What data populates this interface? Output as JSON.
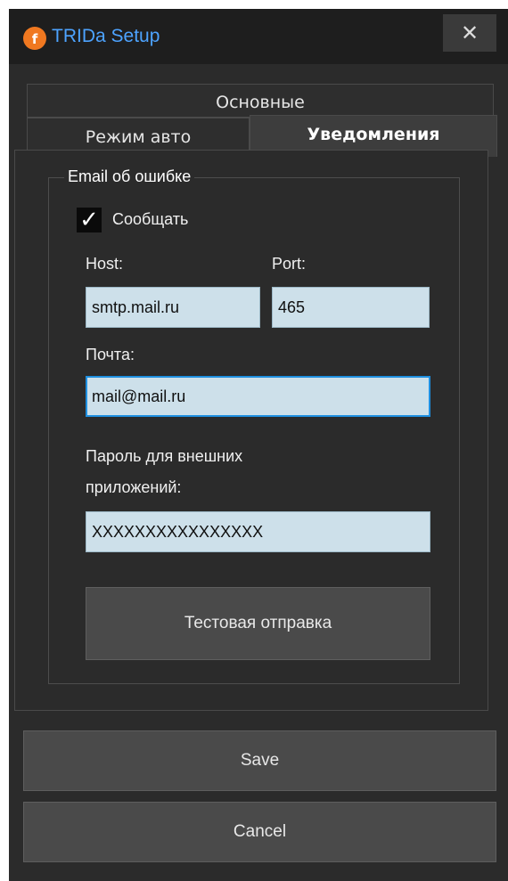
{
  "window": {
    "title": "TRIDa Setup",
    "close_label": "✕"
  },
  "tabs": [
    {
      "label": "Основные"
    },
    {
      "label": "Режим авто"
    },
    {
      "label": "Уведомления"
    }
  ],
  "notifications": {
    "group_title": "Email об ошибке",
    "report_checkbox": {
      "label": "Сообщать",
      "checked": true
    },
    "host": {
      "label": "Host:",
      "value": "smtp.mail.ru"
    },
    "port": {
      "label": "Port:",
      "value": "465"
    },
    "email": {
      "label": "Почта:",
      "value": "mail@mail.ru"
    },
    "password": {
      "label_line1": "Пароль для внешних",
      "label_line2": "приложений:",
      "value": "XXXXXXXXXXXXXXXX"
    },
    "test_button": "Тестовая отправка"
  },
  "footer": {
    "save": "Save",
    "cancel": "Cancel"
  },
  "colors": {
    "accent": "#4da3ff",
    "logo": "#f07820",
    "input_bg": "#cde0ea",
    "focus_border": "#1e8fe0"
  },
  "icons": {
    "app": "trida-logo-icon",
    "close": "close-icon",
    "check": "checkmark-icon"
  }
}
